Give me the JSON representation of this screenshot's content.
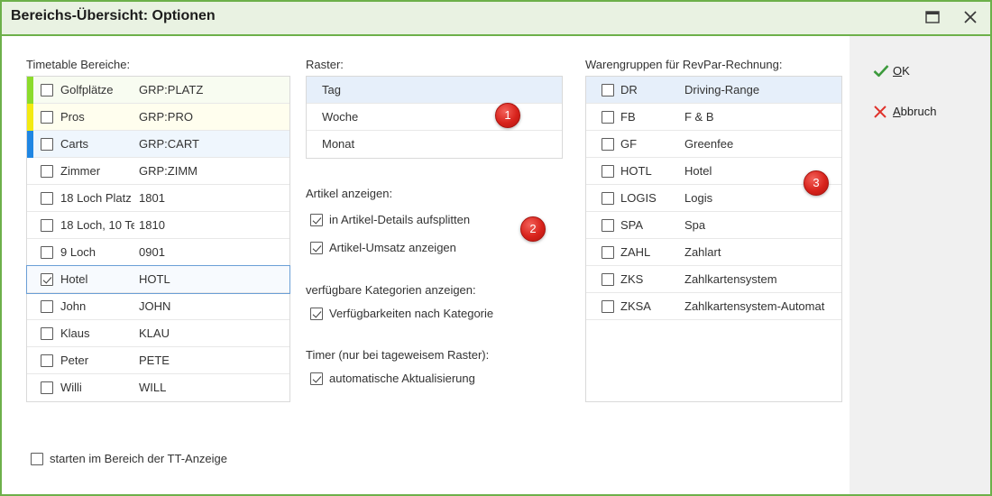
{
  "window": {
    "title": "Bereichs-Übersicht: Optionen",
    "icons": [
      "maximize-icon",
      "close-icon"
    ]
  },
  "colors": {
    "frame_border": "#6db04a",
    "titlebar_bg": "#e9f2e2",
    "sidebar_bg": "#f0f0f0",
    "selection_bg": "#e6effa",
    "selection_border": "#6b9fd6",
    "badge_red": "#d8231c"
  },
  "timetable": {
    "label": "Timetable Bereiche:",
    "items": [
      {
        "name": "Golfplätze",
        "code": "GRP:PLATZ",
        "checked": false,
        "color": "#8cdb2b",
        "tint": "#f8fcf1"
      },
      {
        "name": "Pros",
        "code": "GRP:PRO",
        "checked": false,
        "color": "#f3ea12",
        "tint": "#fffeee"
      },
      {
        "name": "Carts",
        "code": "GRP:CART",
        "checked": false,
        "color": "#1f86e3",
        "tint": "#eff6fd"
      },
      {
        "name": "Zimmer",
        "code": "GRP:ZIMM",
        "checked": false
      },
      {
        "name": "18 Loch Platz",
        "code": "1801",
        "checked": false
      },
      {
        "name": "18 Loch, 10 Te",
        "code": "1810",
        "checked": false
      },
      {
        "name": "9 Loch",
        "code": "0901",
        "checked": false
      },
      {
        "name": "Hotel",
        "code": "HOTL",
        "checked": true,
        "selected": true
      },
      {
        "name": "John",
        "code": "JOHN",
        "checked": false
      },
      {
        "name": "Klaus",
        "code": "KLAU",
        "checked": false
      },
      {
        "name": "Peter",
        "code": "PETE",
        "checked": false
      },
      {
        "name": "Willi",
        "code": "WILL",
        "checked": false
      }
    ]
  },
  "raster": {
    "label": "Raster:",
    "options": [
      {
        "label": "Tag",
        "selected": true
      },
      {
        "label": "Woche",
        "selected": false
      },
      {
        "label": "Monat",
        "selected": false
      }
    ]
  },
  "artikel": {
    "label": "Artikel anzeigen:",
    "options": [
      {
        "label": "in Artikel-Details aufsplitten",
        "checked": true
      },
      {
        "label": "Artikel-Umsatz anzeigen",
        "checked": true
      }
    ]
  },
  "kategorien": {
    "label": "verfügbare Kategorien anzeigen:",
    "options": [
      {
        "label": "Verfügbarkeiten nach Kategorie",
        "checked": true
      }
    ]
  },
  "timer": {
    "label": "Timer (nur bei tageweisem Raster):",
    "options": [
      {
        "label": "automatische Aktualisierung",
        "checked": true
      }
    ]
  },
  "warengruppen": {
    "label": "Warengruppen für RevPar-Rechnung:",
    "items": [
      {
        "code": "DR",
        "name": "Driving-Range",
        "checked": false,
        "selected": true
      },
      {
        "code": "FB",
        "name": "F & B",
        "checked": false
      },
      {
        "code": "GF",
        "name": "Greenfee",
        "checked": false
      },
      {
        "code": "HOTL",
        "name": "Hotel",
        "checked": false
      },
      {
        "code": "LOGIS",
        "name": "Logis",
        "checked": false
      },
      {
        "code": "SPA",
        "name": "Spa",
        "checked": false
      },
      {
        "code": "ZAHL",
        "name": "Zahlart",
        "checked": false
      },
      {
        "code": "ZKS",
        "name": "Zahlkartensystem",
        "checked": false
      },
      {
        "code": "ZKSA",
        "name": "Zahlkartensystem-Automat",
        "checked": false
      }
    ]
  },
  "start_option": {
    "label": "starten im Bereich der TT-Anzeige",
    "checked": false
  },
  "badges": [
    "1",
    "2",
    "3"
  ],
  "actions": {
    "ok": {
      "label": "OK",
      "icon": "checkmark-icon",
      "color": "#3c9a3c"
    },
    "cancel": {
      "label": "Abbruch",
      "icon": "cross-icon",
      "color": "#e0322b"
    }
  }
}
